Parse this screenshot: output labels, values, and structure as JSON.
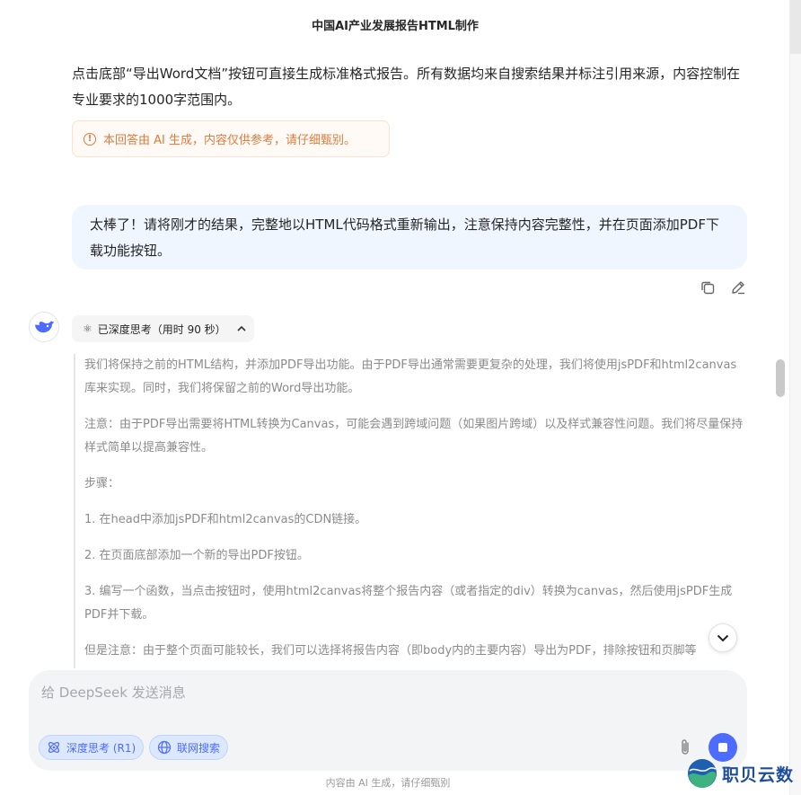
{
  "header": {
    "title": "中国AI产业发展报告HTML制作"
  },
  "assistant_prev": {
    "text": "点击底部“导出Word文档”按钮可直接生成标准格式报告。所有数据均来自搜索结果并标注引用来源，内容控制在专业要求的1000字范围内。",
    "disclaimer": "本回答由 AI 生成，内容仅供参考，请仔细甄别。"
  },
  "user_message": {
    "text": "太棒了！请将刚才的结果，完整地以HTML代码格式重新输出，注意保持内容完整性，并在页面添加PDF下载功能按钮。"
  },
  "message_actions": {
    "copy_icon": "copy-icon",
    "edit_icon": "edit-icon"
  },
  "thinking": {
    "chip_label": "已深度思考（用时 90 秒）",
    "paragraphs": [
      "我们将保持之前的HTML结构，并添加PDF导出功能。由于PDF导出通常需要更复杂的处理，我们将使用jsPDF和html2canvas库来实现。同时，我们将保留之前的Word导出功能。",
      "注意：由于PDF导出需要将HTML转换为Canvas，可能会遇到跨域问题（如果图片跨域）以及样式兼容性问题。我们将尽量保持样式简单以提高兼容性。",
      "步骤：",
      "1. 在head中添加jsPDF和html2canvas的CDN链接。",
      "2. 在页面底部添加一个新的导出PDF按钮。",
      "3. 编写一个函数，当点击按钮时，使用html2canvas将整个报告内容（或者指定的div）转换为canvas，然后使用jsPDF生成PDF并下载。",
      "但是注意：由于整个页面可能较长，我们可以选择将报告内容（即body内的主要内容）导出为PDF，排除按钮和页脚等"
    ]
  },
  "composer": {
    "placeholder": "给 DeepSeek 发送消息",
    "deep_think_label": "深度思考 (R1)",
    "web_search_label": "联网搜索"
  },
  "footer": {
    "note": "内容由 AI 生成，请仔细甄别"
  },
  "watermark": {
    "text": "职贝云数"
  },
  "colors": {
    "accent": "#4d6bfe",
    "user_bubble": "#eff6ff",
    "warning": "#e07b3d",
    "composer_bg": "#f3f4f6"
  }
}
